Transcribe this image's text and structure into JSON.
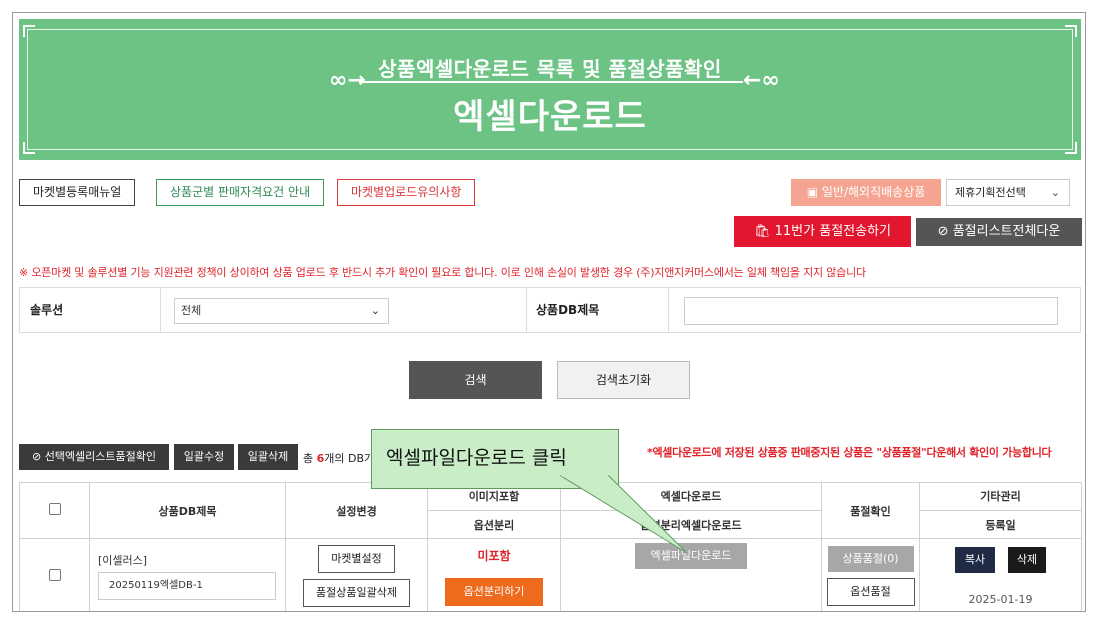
{
  "banner": {
    "subtitle": "상품엑셀다운로드 목록 및 품절상품확인",
    "title": "엑셀다운로드"
  },
  "top_buttons": {
    "market_manual": "마켓별등록매뉴얼",
    "group_guide": "상품군별 판매자격요건 안내",
    "upload_notice": "마켓별업로드유의사항",
    "general_overseas": "일반/해외직배송상품",
    "partner_select": "제휴기획전선택",
    "send_11st": "11번가 품절전송하기",
    "soldout_list_all": "품절리스트전체다운"
  },
  "notice": "※ 오픈마켓 및 솔루션별 기능 지원관련 정책이 상이하여 상품 업로드 후 반드시 추가 확인이 필요로 합니다. 이로 인해 손실이 발생한 경우 (주)지앤지커머스에서는 일체 책임을 지지 않습니다",
  "search": {
    "solution_label": "솔루션",
    "solution_value": "전체",
    "db_title_label": "상품DB제목",
    "db_title_value": "",
    "search_button": "검색",
    "reset_button": "검색초기화"
  },
  "actions": {
    "check_selected": "선택엑셀리스트품절확인",
    "bulk_edit": "일괄수정",
    "bulk_delete": "일괄삭제",
    "count_prefix": "총 ",
    "count": "6",
    "count_suffix": "개의 DB가",
    "red_note": "*엑셀다운로드에 저장된 상품중 판매중지된 상품은 \"상품품절\"다운해서 확인이 가능합니다"
  },
  "callout": {
    "text": "엑셀파일다운로드 클릭"
  },
  "table": {
    "headers": {
      "db_title": "상품DB제목",
      "settings": "설정변경",
      "image_incl": "이미지포함",
      "option_split": "옵션분리",
      "excel_download": "엑셀다운로드",
      "option_split_excel": "옵션분리엑셀다운로드",
      "soldout_check": "품절확인",
      "etc": "기타관리",
      "reg_date": "등록일"
    },
    "rows": [
      {
        "brand": "[이셀러스]",
        "db_name": "20250119엑셀DB-1",
        "market_setting": "마켓별설정",
        "soldout_bulk_delete": "품절상품일괄삭제",
        "image_status": "미포함",
        "option_split_button": "옵션분리하기",
        "excel_file_download": "엑셀파일다운로드",
        "product_soldout": "상품품절(0)",
        "option_soldout": "옵션품절",
        "copy": "복사",
        "delete": "삭제",
        "date": "2025-01-19"
      }
    ]
  },
  "colors": {
    "banner_green": "#6cc384",
    "accent_red": "#e3162f",
    "orange": "#f06a1e",
    "callout_green": "#c9edc7"
  }
}
